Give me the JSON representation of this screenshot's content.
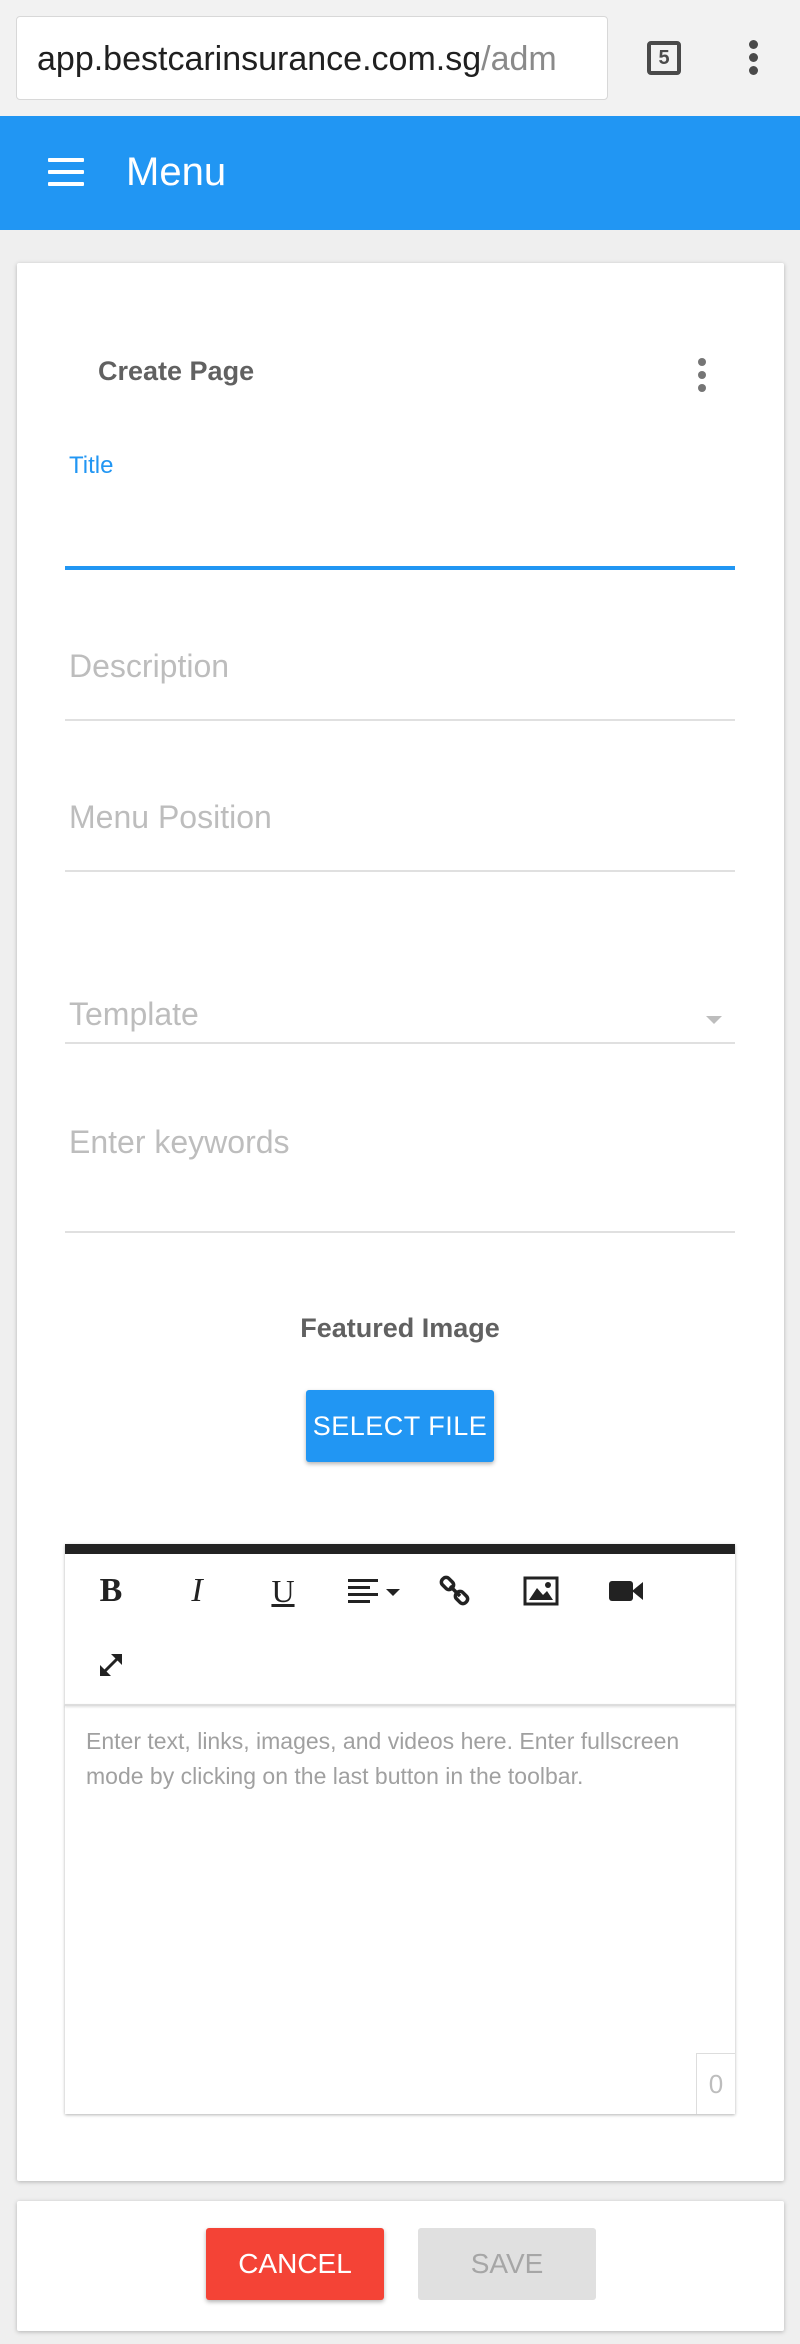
{
  "browser": {
    "url_host": "app.bestcarinsurance.com.sg",
    "url_path": "/adm",
    "tab_count": "5"
  },
  "appbar": {
    "title": "Menu"
  },
  "form": {
    "heading": "Create Page",
    "title_label": "Title",
    "title_value": "",
    "description_placeholder": "Description",
    "menu_position_placeholder": "Menu Position",
    "template_placeholder": "Template",
    "keywords_placeholder": "Enter keywords",
    "featured_image_label": "Featured Image",
    "select_file_label": "SELECT FILE"
  },
  "editor": {
    "toolbar": [
      {
        "name": "bold-button",
        "glyph": "B"
      },
      {
        "name": "italic-button",
        "glyph": "I"
      },
      {
        "name": "underline-button",
        "glyph": "U"
      }
    ],
    "placeholder": "Enter text, links, images, and videos here. Enter fullscreen mode by clicking on the last button in the toolbar.",
    "char_count": "0"
  },
  "actions": {
    "cancel_label": "CANCEL",
    "save_label": "SAVE"
  },
  "colors": {
    "primary": "#2196f3",
    "danger": "#f44336",
    "disabled": "#e0e0e0"
  }
}
